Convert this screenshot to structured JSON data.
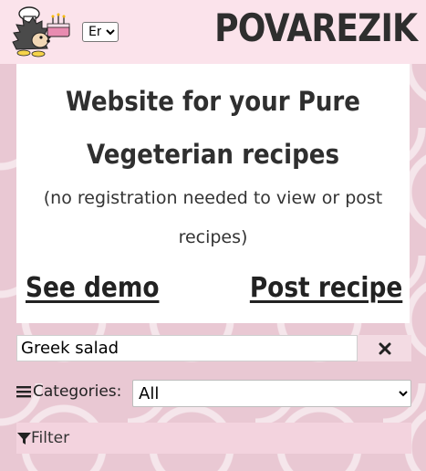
{
  "header": {
    "brand": "POVAREZIK",
    "language_selected": "En"
  },
  "hero": {
    "title_line1": "Website for your Pure",
    "title_line2": "Vegeterian recipes",
    "note_line1": "(no registration needed to view or post",
    "note_line2": "recipes)",
    "demo_link": "See demo",
    "post_link": "Post recipe"
  },
  "search": {
    "value": "Greek salad",
    "clear_icon": "close-icon"
  },
  "categories": {
    "label": "Categories:",
    "selected": "All",
    "icon": "hamburger-icon"
  },
  "filter": {
    "label": "Filter",
    "icon": "funnel-icon"
  },
  "colors": {
    "header_bg": "#fbe3eb",
    "page_bg": "#e9c8d3",
    "filter_bg": "#f3d3de"
  }
}
